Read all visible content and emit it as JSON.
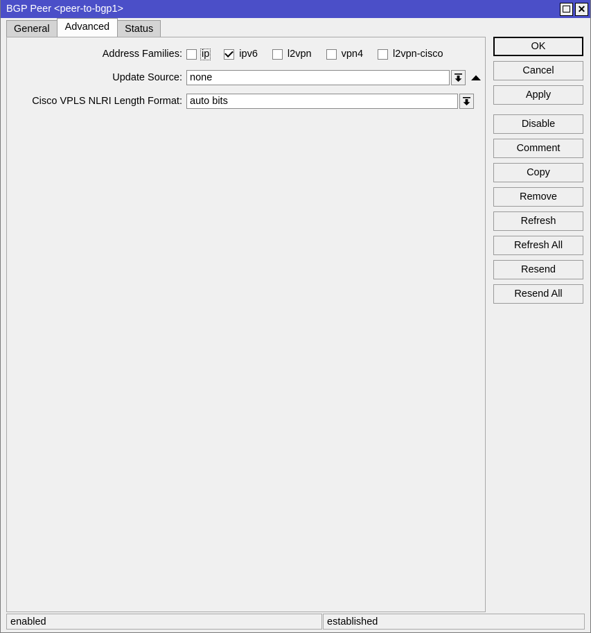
{
  "window": {
    "title": "BGP Peer <peer-to-bgp1>",
    "controls": {
      "maximize": "maximize-icon",
      "close": "close-icon"
    }
  },
  "tabs": [
    {
      "label": "General",
      "active": false
    },
    {
      "label": "Advanced",
      "active": true
    },
    {
      "label": "Status",
      "active": false
    }
  ],
  "form": {
    "address_families": {
      "label": "Address Families:",
      "options": [
        {
          "label": "ip",
          "checked": false,
          "focused": true
        },
        {
          "label": "ipv6",
          "checked": true,
          "focused": false
        },
        {
          "label": "l2vpn",
          "checked": false,
          "focused": false
        },
        {
          "label": "vpn4",
          "checked": false,
          "focused": false
        },
        {
          "label": "l2vpn-cisco",
          "checked": false,
          "focused": false
        }
      ]
    },
    "update_source": {
      "label": "Update Source:",
      "value": "none",
      "dropdown_icon": "dropdown-arrow-icon",
      "expand_icon": "up-triangle-icon"
    },
    "cisco_vpls_nlri_length_format": {
      "label": "Cisco VPLS NLRI Length Format:",
      "value": "auto bits",
      "dropdown_icon": "dropdown-arrow-icon"
    }
  },
  "buttons": [
    {
      "label": "OK",
      "default": true,
      "gap_after": false
    },
    {
      "label": "Cancel",
      "default": false,
      "gap_after": false
    },
    {
      "label": "Apply",
      "default": false,
      "gap_after": true
    },
    {
      "label": "Disable",
      "default": false,
      "gap_after": false
    },
    {
      "label": "Comment",
      "default": false,
      "gap_after": false
    },
    {
      "label": "Copy",
      "default": false,
      "gap_after": false
    },
    {
      "label": "Remove",
      "default": false,
      "gap_after": false
    },
    {
      "label": "Refresh",
      "default": false,
      "gap_after": false
    },
    {
      "label": "Refresh All",
      "default": false,
      "gap_after": false
    },
    {
      "label": "Resend",
      "default": false,
      "gap_after": false
    },
    {
      "label": "Resend All",
      "default": false,
      "gap_after": false
    }
  ],
  "statusbar": {
    "left": "enabled",
    "right": "established"
  },
  "colors": {
    "titlebar": "#4b4fc8",
    "titlebar_text": "#ffffff",
    "window_bg": "#efefef",
    "panel_bg": "#f0f0f0",
    "field_bg": "#ffffff",
    "border": "#9a9a9a",
    "tab_inactive": "#d4d4d4",
    "tab_active": "#fdfdfd"
  }
}
